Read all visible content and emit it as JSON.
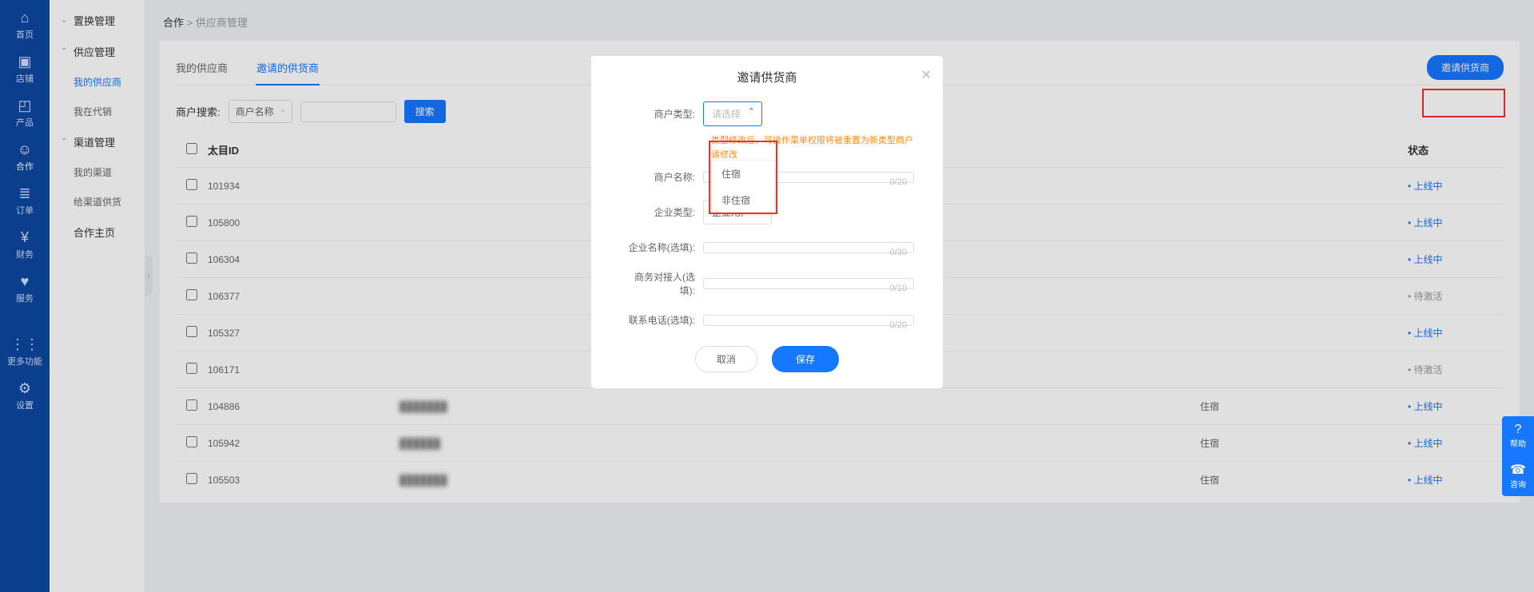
{
  "rail": [
    {
      "icon": "⌂",
      "label": "首页"
    },
    {
      "icon": "▣",
      "label": "店铺"
    },
    {
      "icon": "◰",
      "label": "产品"
    },
    {
      "icon": "☺",
      "label": "合作",
      "active": true
    },
    {
      "icon": "≣",
      "label": "订单"
    },
    {
      "icon": "¥",
      "label": "财务"
    },
    {
      "icon": "♥",
      "label": "服务"
    },
    {
      "icon": "⋮⋮",
      "label": "更多功能",
      "gap": true
    },
    {
      "icon": "⚙",
      "label": "设置"
    }
  ],
  "subside": {
    "groups": [
      {
        "caret": "⌄",
        "label": "置换管理",
        "items": []
      },
      {
        "caret": "⌃",
        "label": "供应管理",
        "items": [
          {
            "label": "我的供应商",
            "active": true
          },
          {
            "label": "我在代销"
          }
        ]
      },
      {
        "caret": "⌃",
        "label": "渠道管理",
        "items": [
          {
            "label": "我的渠道"
          },
          {
            "label": "给渠道供货"
          }
        ]
      },
      {
        "caret": "",
        "label": "合作主页",
        "items": []
      }
    ]
  },
  "crumb": {
    "a": "合作",
    "b": "供应商管理"
  },
  "tabs": {
    "a": "我的供应商",
    "b": "邀请的供货商"
  },
  "invite_btn": "邀请供货商",
  "search": {
    "label": "商户搜索:",
    "sel": "商户名称",
    "btn": "搜索"
  },
  "cols": {
    "id": "太目ID",
    "status": "状态"
  },
  "rows": [
    {
      "id": "101934",
      "name": "",
      "type": "",
      "status": "上线中",
      "gray": false
    },
    {
      "id": "105800",
      "name": "",
      "type": "",
      "status": "上线中",
      "gray": false
    },
    {
      "id": "106304",
      "name": "",
      "type": "",
      "status": "上线中",
      "gray": false
    },
    {
      "id": "106377",
      "name": "",
      "type": "",
      "status": "待激活",
      "gray": true
    },
    {
      "id": "105327",
      "name": "",
      "type": "",
      "status": "上线中",
      "gray": false
    },
    {
      "id": "106171",
      "name": "",
      "type": "",
      "status": "待激活",
      "gray": true
    },
    {
      "id": "104886",
      "name": "███████",
      "type": "住宿",
      "status": "上线中",
      "gray": false
    },
    {
      "id": "105942",
      "name": "██████",
      "type": "住宿",
      "status": "上线中",
      "gray": false
    },
    {
      "id": "105503",
      "name": "███████",
      "type": "住宿",
      "status": "上线中",
      "gray": false
    }
  ],
  "modal": {
    "title": "邀请供货商",
    "type_lbl": "商户类型:",
    "type_ph": "请选择",
    "warn": "类型修改后，可操作菜单权限将被重置为新类型商户 请修改",
    "name_lbl": "商户名称:",
    "name_cnt": "0/20",
    "ent_lbl": "企业类型:",
    "ent_val": "企业用户",
    "entname_lbl": "企业名称(选填):",
    "entname_cnt": "0/30",
    "contact_lbl": "商务对接人(选填):",
    "contact_cnt": "0/10",
    "phone_lbl": "联系电话(选填):",
    "phone_cnt": "0/20",
    "cancel": "取消",
    "save": "保存",
    "drop": [
      "住宿",
      "非住宿"
    ]
  },
  "float": [
    {
      "icon": "?",
      "label": "帮助"
    },
    {
      "icon": "☎",
      "label": "咨询"
    }
  ]
}
